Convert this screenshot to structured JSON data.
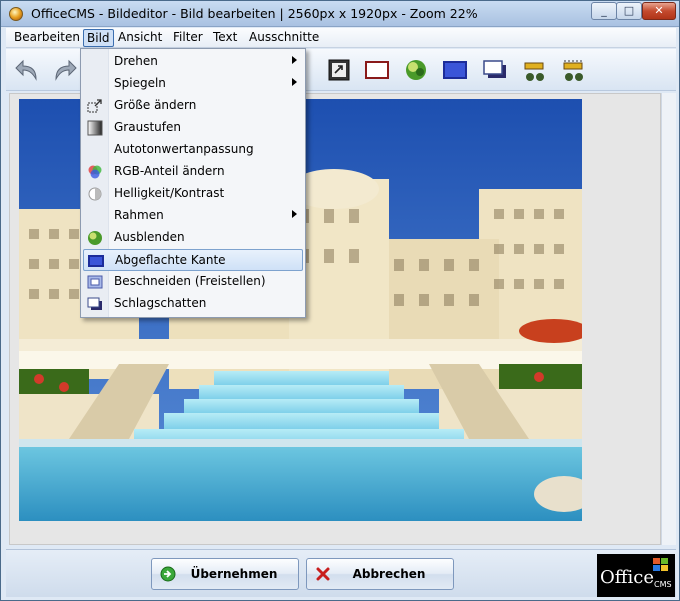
{
  "window": {
    "title": "OfficeCMS - Bildeditor - Bild bearbeiten | 2560px x 1920px - Zoom 22%",
    "minimize": "_",
    "maximize": "□",
    "close": "✕"
  },
  "menubar": {
    "items": [
      {
        "label": "Bearbeiten"
      },
      {
        "label": "Bild"
      },
      {
        "label": "Ansicht"
      },
      {
        "label": "Filter"
      },
      {
        "label": "Text"
      },
      {
        "label": "Ausschnitte"
      }
    ]
  },
  "toolbar": {
    "icons": [
      "undo-arrow-icon",
      "redo-arrow-icon",
      "resize-icon",
      "frame-icon",
      "fade-icon",
      "bevel-icon",
      "shadow-icon",
      "cut-select-icon",
      "cut-select-alt-icon"
    ]
  },
  "bild_menu": {
    "items": [
      {
        "label": "Drehen",
        "icon": "none",
        "submenu": true
      },
      {
        "label": "Spiegeln",
        "icon": "none",
        "submenu": true
      },
      {
        "label": "Größe ändern",
        "icon": "resize-icon",
        "submenu": false
      },
      {
        "label": "Graustufen",
        "icon": "grayscale-icon",
        "submenu": false
      },
      {
        "label": "Autotonwertanpassung",
        "icon": "none",
        "submenu": false
      },
      {
        "label": "RGB-Anteil ändern",
        "icon": "rgb-icon",
        "submenu": false
      },
      {
        "label": "Helligkeit/Kontrast",
        "icon": "brightness-icon",
        "submenu": false
      },
      {
        "label": "Rahmen",
        "icon": "none",
        "submenu": true
      },
      {
        "label": "Ausblenden",
        "icon": "fade-icon",
        "submenu": false
      },
      {
        "label": "Abgeflachte Kante",
        "icon": "bevel-icon",
        "submenu": false,
        "highlighted": true
      },
      {
        "label": "Beschneiden (Freistellen)",
        "icon": "crop-icon",
        "submenu": false
      },
      {
        "label": "Schlagschatten",
        "icon": "shadow-icon",
        "submenu": false
      }
    ]
  },
  "footer": {
    "apply_label": "Übernehmen",
    "cancel_label": "Abbrechen",
    "logo_text": "Office",
    "logo_sub": "CMS"
  }
}
